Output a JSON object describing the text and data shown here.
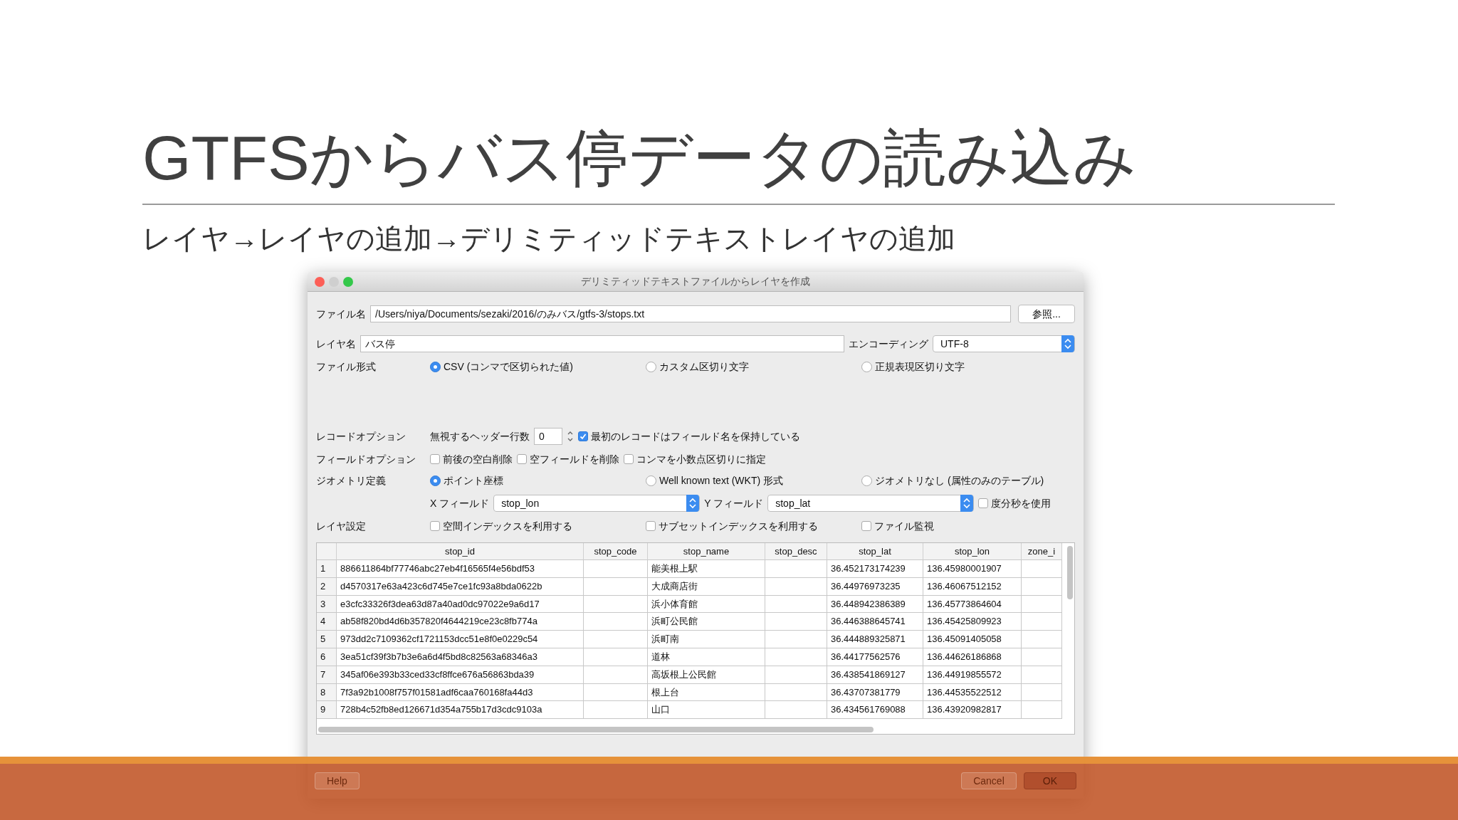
{
  "slide": {
    "title": "GTFSからバス停データの読み込み",
    "subtitle": "レイヤ→レイヤの追加→デリミティッドテキストレイヤの追加"
  },
  "dialog": {
    "title": "デリミティッドテキストファイルからレイヤを作成",
    "file": {
      "label": "ファイル名",
      "value": "/Users/niya/Documents/sezaki/2016/のみバス/gtfs-3/stops.txt",
      "browse": "参照..."
    },
    "layer": {
      "label": "レイヤ名",
      "value": "バス停"
    },
    "encoding": {
      "label": "エンコーディング",
      "value": "UTF-8"
    },
    "file_format": {
      "label": "ファイル形式",
      "options": [
        {
          "label": "CSV (コンマで区切られた値)",
          "selected": true
        },
        {
          "label": "カスタム区切り文字",
          "selected": false
        },
        {
          "label": "正規表現区切り文字",
          "selected": false
        }
      ]
    },
    "record_options": {
      "label": "レコードオプション",
      "skip_label": "無視するヘッダー行数",
      "skip_value": "0",
      "first_record": {
        "label": "最初のレコードはフィールド名を保持している",
        "checked": true
      }
    },
    "field_options": {
      "label": "フィールドオプション",
      "options": [
        {
          "label": "前後の空白削除",
          "checked": false
        },
        {
          "label": "空フィールドを削除",
          "checked": false
        },
        {
          "label": "コンマを小数点区切りに指定",
          "checked": false
        }
      ]
    },
    "geometry": {
      "label": "ジオメトリ定義",
      "options": [
        {
          "label": "ポイント座標",
          "selected": true
        },
        {
          "label": "Well known text (WKT) 形式",
          "selected": false
        },
        {
          "label": "ジオメトリなし (属性のみのテーブル)",
          "selected": false
        }
      ]
    },
    "x_field": {
      "label": "X フィールド",
      "value": "stop_lon"
    },
    "y_field": {
      "label": "Y フィールド",
      "value": "stop_lat"
    },
    "dms": {
      "label": "度分秒を使用",
      "checked": false
    },
    "layer_settings": {
      "label": "レイヤ設定",
      "options": [
        {
          "label": "空間インデックスを利用する",
          "checked": false
        },
        {
          "label": "サブセットインデックスを利用する",
          "checked": false
        },
        {
          "label": "ファイル監視",
          "checked": false
        }
      ]
    },
    "table": {
      "columns": [
        "stop_id",
        "stop_code",
        "stop_name",
        "stop_desc",
        "stop_lat",
        "stop_lon",
        "zone_i"
      ],
      "rows": [
        {
          "num": "1",
          "stop_id": "886611864bf77746abc27eb4f16565f4e56bdf53",
          "stop_name": "能美根上駅",
          "stop_lat": "36.452173174239",
          "stop_lon": "136.45980001907"
        },
        {
          "num": "2",
          "stop_id": "d4570317e63a423c6d745e7ce1fc93a8bda0622b",
          "stop_name": "大成商店街",
          "stop_lat": "36.44976973235",
          "stop_lon": "136.46067512152"
        },
        {
          "num": "3",
          "stop_id": "e3cfc33326f3dea63d87a40ad0dc97022e9a6d17",
          "stop_name": "浜小体育館",
          "stop_lat": "36.448942386389",
          "stop_lon": "136.45773864604"
        },
        {
          "num": "4",
          "stop_id": "ab58f820bd4d6b357820f4644219ce23c8fb774a",
          "stop_name": "浜町公民館",
          "stop_lat": "36.446388645741",
          "stop_lon": "136.45425809923"
        },
        {
          "num": "5",
          "stop_id": "973dd2c7109362cf1721153dcc51e8f0e0229c54",
          "stop_name": "浜町南",
          "stop_lat": "36.444889325871",
          "stop_lon": "136.45091405058"
        },
        {
          "num": "6",
          "stop_id": "3ea51cf39f3b7b3e6a6d4f5bd8c82563a68346a3",
          "stop_name": "道林",
          "stop_lat": "36.44177562576",
          "stop_lon": "136.44626186868"
        },
        {
          "num": "7",
          "stop_id": "345af06e393b33ced33cf8ffce676a56863bda39",
          "stop_name": "高坂根上公民館",
          "stop_lat": "36.438541869127",
          "stop_lon": "136.44919855572"
        },
        {
          "num": "8",
          "stop_id": "7f3a92b1008f757f01581adf6caa760168fa44d3",
          "stop_name": "根上台",
          "stop_lat": "36.43707381779",
          "stop_lon": "136.44535522512"
        },
        {
          "num": "9",
          "stop_id": "728b4c52fb8ed126671d354a755b17d3cdc9103a",
          "stop_name": "山口",
          "stop_lat": "36.434561769088",
          "stop_lon": "136.43920982817"
        }
      ]
    },
    "buttons": [
      {
        "label": "Help",
        "kind": "plain"
      },
      {
        "label": "Cancel",
        "kind": "plain"
      },
      {
        "label": "OK",
        "kind": "default"
      }
    ]
  }
}
